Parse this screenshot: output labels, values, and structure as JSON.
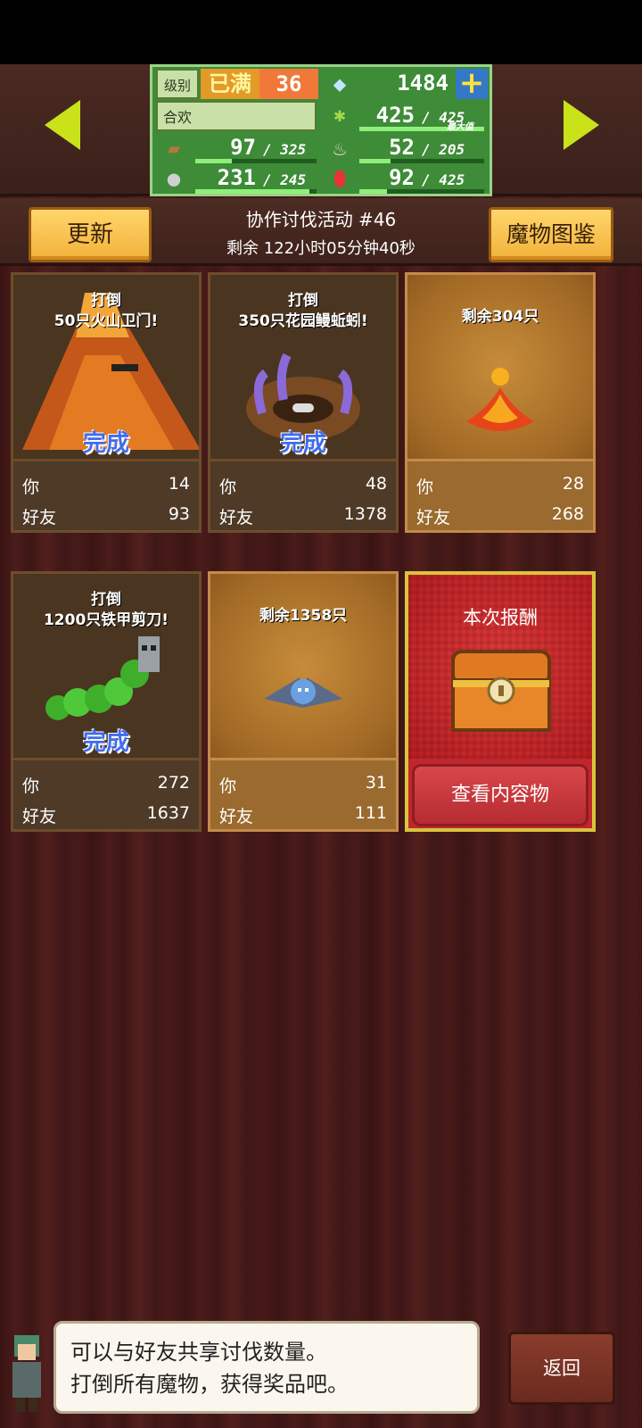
{
  "header": {
    "level_label": "级别",
    "level_status": "已满",
    "level_value": "36",
    "gems": "1484",
    "title": "合欢",
    "stats": [
      {
        "icon": "grass-icon",
        "value": "425",
        "max": "425",
        "max_tag": "最大值",
        "fill": 1.0
      },
      {
        "icon": "wood-log-icon",
        "value": "97",
        "max": "325",
        "fill": 0.3
      },
      {
        "icon": "meat-icon",
        "value": "52",
        "max": "205",
        "fill": 0.25
      },
      {
        "icon": "ore-icon",
        "value": "231",
        "max": "245",
        "fill": 0.94
      },
      {
        "icon": "red-gem-icon",
        "value": "92",
        "max": "425",
        "fill": 0.22
      }
    ]
  },
  "toolbar": {
    "refresh_label": "更新",
    "bestiary_label": "魔物图鉴",
    "event_title": "协作讨伐活动 #46",
    "event_remaining": "剩余 122小时05分钟40秒"
  },
  "cards": [
    {
      "goal": "打倒\n50只火山卫门!",
      "done": "完成",
      "you_label": "你",
      "you": "14",
      "friend_label": "好友",
      "friend": "93",
      "style": "dark",
      "monster": "volcano"
    },
    {
      "goal": "打倒\n350只花园鳗蚯蚓!",
      "done": "完成",
      "you_label": "你",
      "you": "48",
      "friend_label": "好友",
      "friend": "1378",
      "style": "dark",
      "monster": "worm"
    },
    {
      "goal": "剩余304只",
      "done": "",
      "you_label": "你",
      "you": "28",
      "friend_label": "好友",
      "friend": "268",
      "style": "gold",
      "monster": "slime"
    },
    {
      "goal": "打倒\n1200只铁甲剪刀!",
      "done": "完成",
      "you_label": "你",
      "you": "272",
      "friend_label": "好友",
      "friend": "1637",
      "style": "dark",
      "monster": "caterpillar"
    },
    {
      "goal": "剩余1358只",
      "done": "",
      "you_label": "你",
      "you": "31",
      "friend_label": "好友",
      "friend": "111",
      "style": "gold",
      "monster": "bat"
    }
  ],
  "reward": {
    "title": "本次报酬",
    "button": "查看内容物"
  },
  "tip": {
    "line1": "可以与好友共享讨伐数量。",
    "line2": "打倒所有魔物，获得奖品吧。"
  },
  "back_label": "返回",
  "colors": {
    "accent": "#c9e21a",
    "panel_green": "#3e8b38",
    "gold_btn": "#f2b23b",
    "done_blue": "#3f6cf0"
  }
}
